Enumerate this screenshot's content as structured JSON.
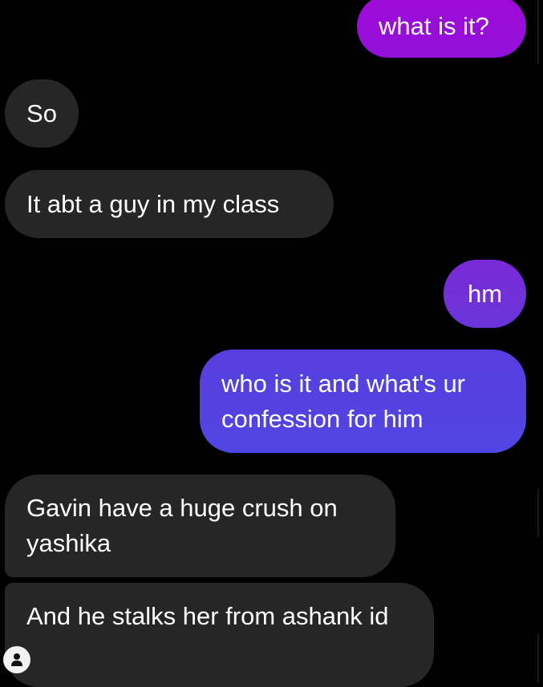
{
  "messages": [
    {
      "sender": "me",
      "text": "what is it?"
    },
    {
      "sender": "them",
      "text": "So"
    },
    {
      "sender": "them",
      "text": "It abt a guy in my class"
    },
    {
      "sender": "me",
      "text": "hm"
    },
    {
      "sender": "me",
      "text": "who is it and what's ur confession for him"
    },
    {
      "sender": "them",
      "text": "Gavin have a huge crush on yashika"
    },
    {
      "sender": "them",
      "text": "And he stalks her from ashank id"
    }
  ],
  "avatar": {
    "icon": "person-icon"
  },
  "colors": {
    "background": "#000000",
    "incoming_bubble": "#262626",
    "outgoing_purple": "#9a0ed9",
    "outgoing_violet": "#7330d8",
    "outgoing_indigo": "#5541e1",
    "text": "#ffffff"
  }
}
